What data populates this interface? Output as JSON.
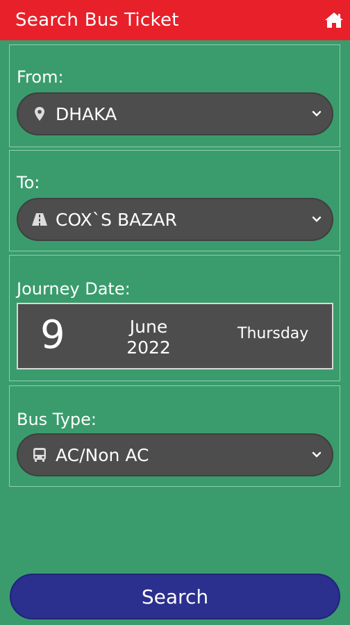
{
  "header": {
    "title": "Search Bus Ticket",
    "home_icon": "home-icon",
    "background": "#e8202a"
  },
  "from": {
    "label": "From:",
    "value": "DHAKA",
    "icon": "map-pin-icon"
  },
  "to": {
    "label": "To:",
    "value": "COX`S BAZAR",
    "icon": "road-icon"
  },
  "journey_date": {
    "label": "Journey Date:",
    "day": "9",
    "month": "June",
    "year": "2022",
    "weekday": "Thursday"
  },
  "bus_type": {
    "label": "Bus Type:",
    "value": "AC/Non AC",
    "icon": "bus-icon"
  },
  "search_button": {
    "label": "Search",
    "color": "#2b2f8e"
  },
  "colors": {
    "page_background": "#3a9c6c",
    "field_background": "#4d4d4d"
  }
}
